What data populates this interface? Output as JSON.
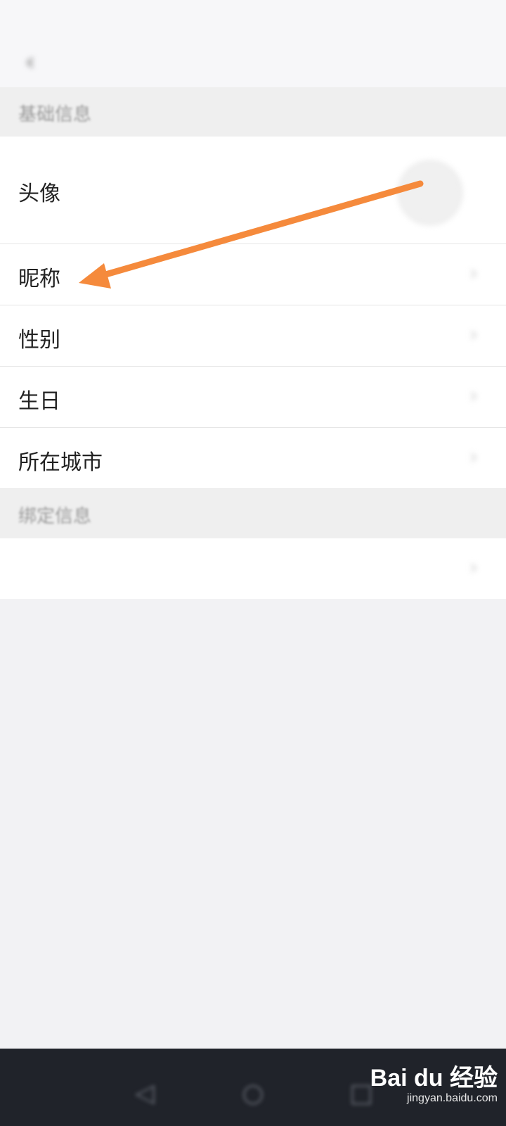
{
  "status_bar": {
    "left_text": "",
    "right_text": ""
  },
  "nav": {
    "title": "",
    "back_icon": "chevron-left-icon"
  },
  "sections": {
    "basic": {
      "header": "基础信息",
      "rows": {
        "avatar": {
          "label": "头像"
        },
        "nickname": {
          "label": "昵称",
          "value": ""
        },
        "gender": {
          "label": "性别",
          "value": ""
        },
        "birthday": {
          "label": "生日",
          "value": ""
        },
        "city": {
          "label": "所在城市",
          "value": ""
        }
      }
    },
    "binding": {
      "header": "绑定信息",
      "rows": {
        "phone": {
          "label": "",
          "value": ""
        }
      }
    }
  },
  "annotation": {
    "arrow_color": "#f58a3c",
    "points_to": "nickname-row"
  },
  "watermark": {
    "main": "Bai du 经验",
    "sub": "jingyan.baidu.com"
  },
  "colors": {
    "page_bg": "#f2f2f4",
    "row_bg": "#ffffff",
    "accent_arrow": "#f58a3c"
  }
}
